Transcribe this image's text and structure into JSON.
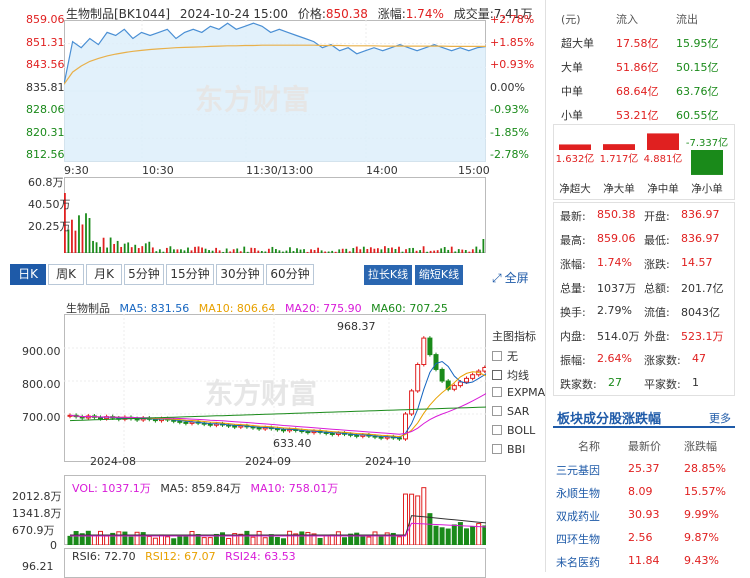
{
  "header": {
    "name": "生物制品[BK1044]",
    "datetime": "2024-10-24 15:00",
    "price_label": "价格:",
    "price": "850.38",
    "change_label": "涨幅:",
    "change": "1.74%",
    "volume_label": "成交量:",
    "volume": "7.41万"
  },
  "watermark": "东方财富",
  "intraday": {
    "y_left": [
      "859.06",
      "851.31",
      "843.56",
      "835.81",
      "828.06",
      "820.31",
      "812.56"
    ],
    "y_right": [
      "+2.78%",
      "+1.85%",
      "+0.93%",
      "0.00%",
      "-0.93%",
      "-1.85%",
      "-2.78%"
    ],
    "x_labels": [
      "9:30",
      "10:30",
      "11:30/13:00",
      "14:00",
      "15:00"
    ],
    "vol_labels": [
      "60.8万",
      "40.50万",
      "20.25万"
    ],
    "price_series": [
      838,
      852,
      850,
      853,
      851,
      855,
      854,
      856,
      853,
      855,
      854,
      855,
      856,
      853,
      855,
      856,
      855,
      857,
      856,
      858,
      856,
      857,
      858,
      857,
      855,
      856,
      855,
      854,
      853,
      852,
      850,
      851,
      849,
      850,
      848,
      849,
      850,
      849,
      850,
      851,
      850,
      849,
      850,
      851,
      850,
      849,
      850,
      849,
      850,
      850.38
    ],
    "avg_series": [
      838,
      842,
      844,
      845.5,
      846.5,
      847.3,
      847.9,
      848.4,
      848.8,
      849.1,
      849.4,
      849.6,
      849.8,
      850,
      850.1,
      850.2,
      850.3,
      850.4,
      850.5,
      850.6,
      850.6,
      850.7,
      850.7,
      850.8,
      850.8,
      850.8,
      850.8,
      850.8,
      850.8,
      850.8,
      850.7,
      850.7,
      850.7,
      850.6,
      850.6,
      850.6,
      850.6,
      850.5,
      850.5,
      850.5,
      850.5,
      850.5,
      850.5,
      850.5,
      850.5,
      850.4,
      850.4,
      850.4,
      850.4,
      850.4
    ]
  },
  "tabs": [
    "日K",
    "周K",
    "月K",
    "5分钟",
    "15分钟",
    "30分钟",
    "60分钟"
  ],
  "zoom_buttons": {
    "expand": "拉长K线",
    "shrink": "缩短K线"
  },
  "fullscreen": "全屏",
  "kline": {
    "legend": {
      "name": "生物制品",
      "ma5": "MA5: 831.56",
      "ma10": "MA10: 806.64",
      "ma20": "MA20: 775.90",
      "ma60": "MA60: 707.25"
    },
    "y_labels": [
      "900.00",
      "800.00",
      "700.00"
    ],
    "x_labels": [
      "2024-08",
      "2024-09",
      "2024-10"
    ],
    "high_mark": "968.37",
    "low_mark": "633.40",
    "ma_colors": {
      "ma5": "#1565c0",
      "ma10": "#e8a100",
      "ma20": "#d81bd8",
      "ma60": "#1a8a1a"
    }
  },
  "indicator_panel": {
    "title": "主图指标",
    "items": [
      "无",
      "均线",
      "EXPMA",
      "SAR",
      "BOLL",
      "BBI"
    ],
    "selected": "均线"
  },
  "volume_panel": {
    "legend": {
      "vol": "VOL: 1037.1万",
      "ma5": "MA5: 859.84万",
      "ma10": "MA10: 758.01万"
    },
    "y_labels": [
      "2012.8万",
      "1341.8万",
      "670.9万",
      "0"
    ]
  },
  "rsi_panel": {
    "legend": {
      "rsi6": "RSI6: 72.70",
      "rsi12": "RSI12: 67.07",
      "rsi24": "RSI24: 63.53"
    },
    "y_label": "96.21"
  },
  "flow_table": {
    "headers": [
      "(元)",
      "流入",
      "流出"
    ],
    "rows": [
      {
        "name": "超大单",
        "in": "17.58亿",
        "out": "15.95亿"
      },
      {
        "name": "大单",
        "in": "51.86亿",
        "out": "50.15亿"
      },
      {
        "name": "中单",
        "in": "68.64亿",
        "out": "63.76亿"
      },
      {
        "name": "小单",
        "in": "53.21亿",
        "out": "60.55亿"
      }
    ]
  },
  "net_flow": {
    "values": [
      1.632,
      1.717,
      4.881,
      -7.337
    ],
    "value_labels": [
      "1.632亿",
      "1.717亿",
      "4.881亿",
      "-7.337亿"
    ],
    "labels": [
      "净超大",
      "净大单",
      "净中单",
      "净小单"
    ]
  },
  "stats": [
    {
      "k1": "最新:",
      "v1": "850.38",
      "k2": "开盘:",
      "v2": "836.97"
    },
    {
      "k1": "最高:",
      "v1": "859.06",
      "k2": "最低:",
      "v2": "836.97"
    },
    {
      "k1": "涨幅:",
      "v1": "1.74%",
      "k2": "涨跌:",
      "v2": "14.57"
    },
    {
      "k1": "总量:",
      "v1": "1037万",
      "k2": "总额:",
      "v2": "201.7亿"
    },
    {
      "k1": "换手:",
      "v1": "2.79%",
      "k2": "流值:",
      "v2": "8043亿"
    },
    {
      "k1": "内盘:",
      "v1": "514.0万",
      "k2": "外盘:",
      "v2": "523.1万"
    },
    {
      "k1": "振幅:",
      "v1": "2.64%",
      "k2": "涨家数:",
      "v2": "47"
    },
    {
      "k1": "跌家数:",
      "v1": "27",
      "k2": "平家数:",
      "v2": "1"
    }
  ],
  "constituents": {
    "title": "板块成分股涨跌幅",
    "more": "更多",
    "headers": [
      "名称",
      "最新价",
      "涨跌幅"
    ],
    "rows": [
      {
        "name": "三元基因",
        "price": "25.37",
        "pct": "28.85%"
      },
      {
        "name": "永顺生物",
        "price": "8.09",
        "pct": "15.57%"
      },
      {
        "name": "双成药业",
        "price": "30.93",
        "pct": "9.99%"
      },
      {
        "name": "四环生物",
        "price": "2.56",
        "pct": "9.87%"
      },
      {
        "name": "未名医药",
        "price": "11.84",
        "pct": "9.43%"
      }
    ]
  },
  "colors": {
    "up": "#e02020",
    "down": "#1a8a1a",
    "accent": "#1e5aa8",
    "price_line": "#4a8fd4"
  }
}
